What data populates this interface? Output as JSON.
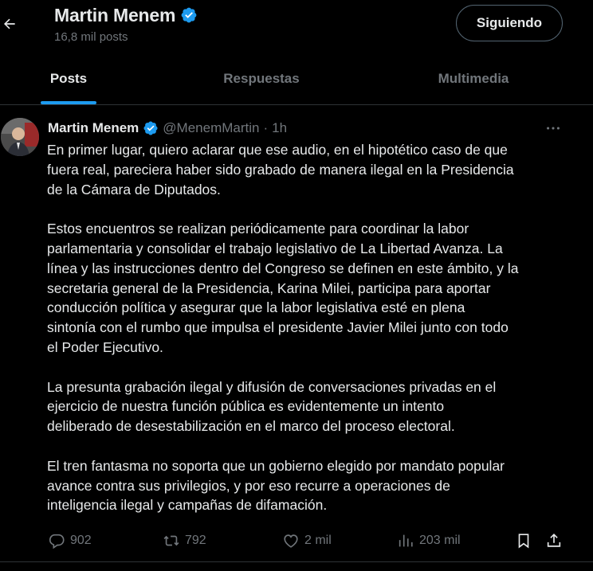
{
  "header": {
    "name": "Martin Menem",
    "posts_count": "16,8 mil posts",
    "follow_label": "Siguiendo"
  },
  "tabs": [
    {
      "label": "Posts"
    },
    {
      "label": "Respuestas"
    },
    {
      "label": "Multimedia"
    }
  ],
  "post": {
    "author": "Martin Menem",
    "handle": "@MenemMartin",
    "dot": "·",
    "time": "1h",
    "text": "En primer lugar, quiero aclarar que ese audio, en el hipotético caso de que\nfuera real, pareciera haber sido grabado de manera ilegal en la Presidencia\nde la Cámara de Diputados.\n\nEstos encuentros se realizan periódicamente para coordinar la labor\nparlamentaria y consolidar el trabajo legislativo de La Libertad Avanza. La\nlínea y las instrucciones dentro del Congreso se definen en este ámbito, y la\nsecretaria general de la Presidencia, Karina Milei, participa para aportar\nconducción política y asegurar que la labor legislativa esté en plena\nsintonía con el rumbo que impulsa el presidente Javier Milei junto con todo\nel Poder Ejecutivo.\n\nLa presunta grabación ilegal y difusión de conversaciones privadas en el\nejercicio de nuestra función pública es evidentemente un intento\ndeliberado de desestabilización en el marco del proceso electoral.\n\nEl tren fantasma no soporta que un gobierno elegido por mandato popular\navance contra sus privilegios, y por eso recurre a operaciones de\ninteligencia ilegal y campañas de difamación.",
    "stats": {
      "replies": "902",
      "reposts": "792",
      "likes": "2 mil",
      "views": "203 mil"
    }
  },
  "colors": {
    "accent": "#1d9bf0",
    "muted": "#71767b",
    "text": "#e7e9ea",
    "background": "#000000"
  }
}
